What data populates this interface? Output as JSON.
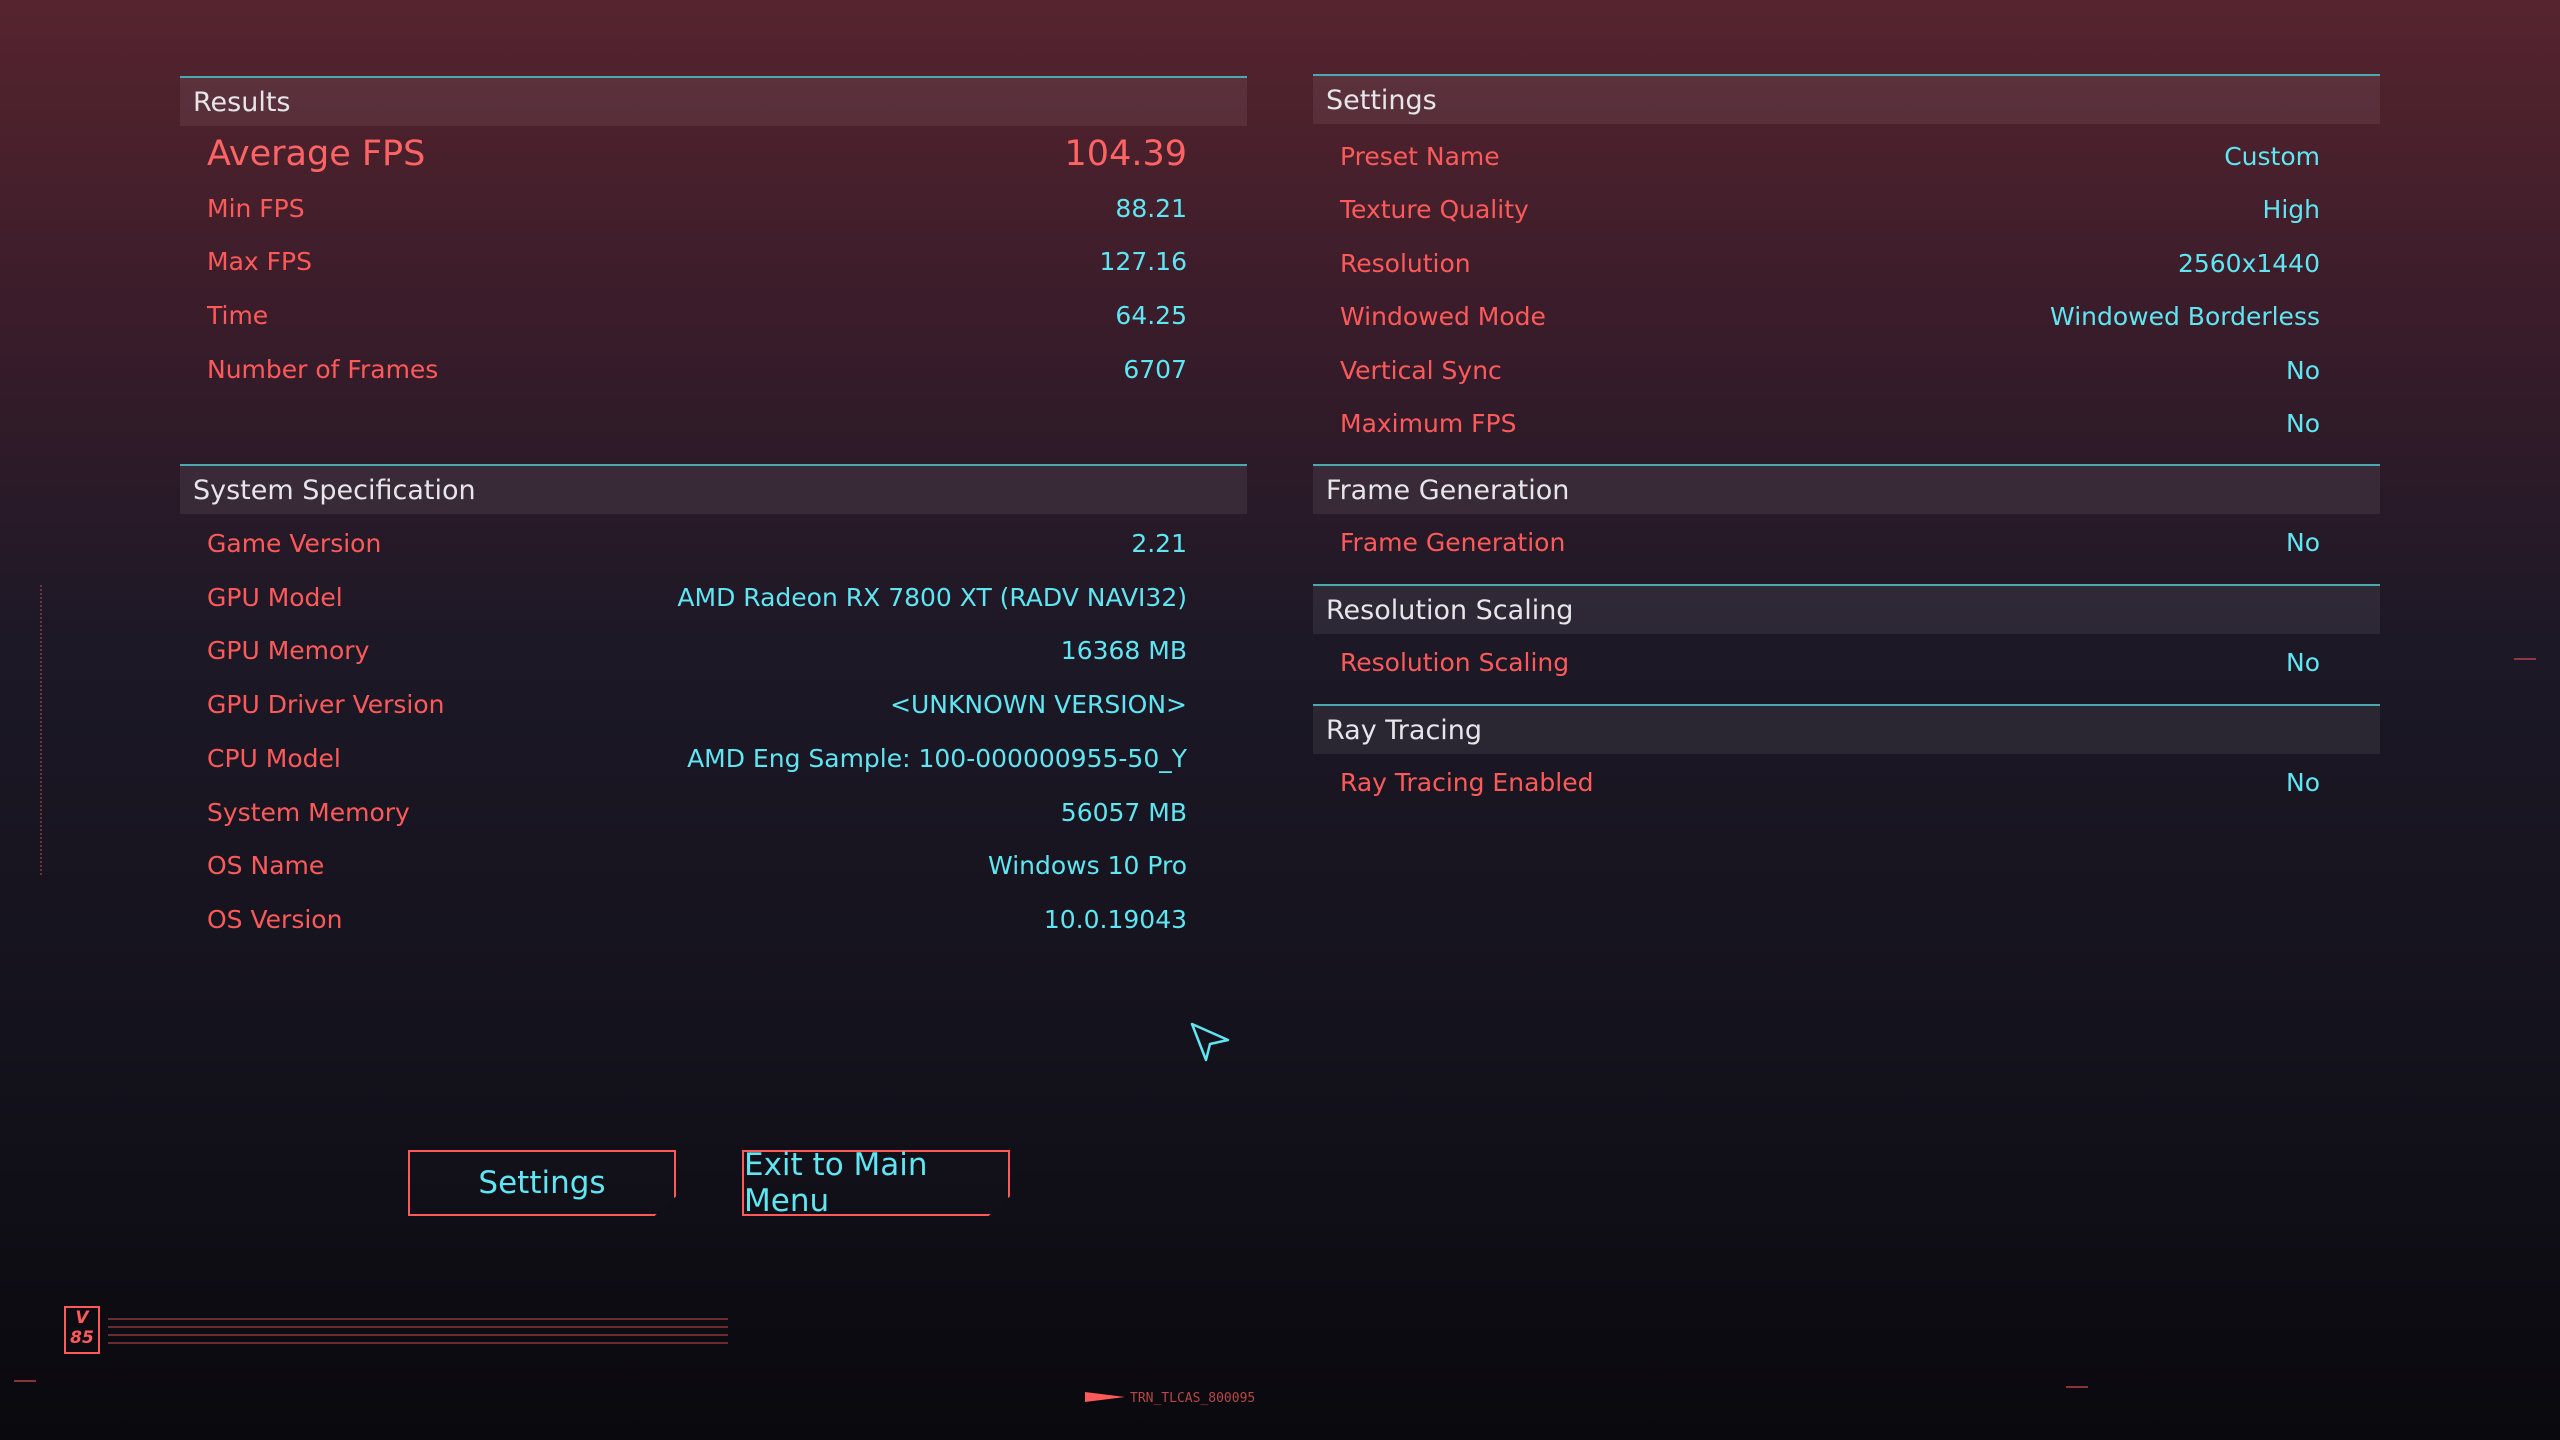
{
  "results": {
    "title": "Results",
    "average_fps_label": "Average FPS",
    "average_fps_value": "104.39",
    "rows": [
      {
        "label": "Min FPS",
        "value": "88.21"
      },
      {
        "label": "Max FPS",
        "value": "127.16"
      },
      {
        "label": "Time",
        "value": "64.25"
      },
      {
        "label": "Number of Frames",
        "value": "6707"
      }
    ]
  },
  "system": {
    "title": "System Specification",
    "rows": [
      {
        "label": "Game Version",
        "value": "2.21"
      },
      {
        "label": "GPU Model",
        "value": "AMD Radeon RX 7800 XT (RADV NAVI32)"
      },
      {
        "label": "GPU Memory",
        "value": "16368 MB"
      },
      {
        "label": "GPU Driver Version",
        "value": "<UNKNOWN VERSION>"
      },
      {
        "label": "CPU Model",
        "value": "AMD Eng Sample: 100-000000955-50_Y"
      },
      {
        "label": "System Memory",
        "value": "56057 MB"
      },
      {
        "label": "OS Name",
        "value": "Windows 10 Pro"
      },
      {
        "label": "OS Version",
        "value": "10.0.19043"
      }
    ]
  },
  "settings": {
    "title": "Settings",
    "rows": [
      {
        "label": "Preset Name",
        "value": "Custom"
      },
      {
        "label": "Texture Quality",
        "value": "High"
      },
      {
        "label": "Resolution",
        "value": "2560x1440"
      },
      {
        "label": "Windowed Mode",
        "value": "Windowed Borderless"
      },
      {
        "label": "Vertical Sync",
        "value": "No"
      },
      {
        "label": "Maximum FPS",
        "value": "No"
      }
    ]
  },
  "frame_generation": {
    "title": "Frame Generation",
    "rows": [
      {
        "label": "Frame Generation",
        "value": "No"
      }
    ]
  },
  "resolution_scaling": {
    "title": "Resolution Scaling",
    "rows": [
      {
        "label": "Resolution Scaling",
        "value": "No"
      }
    ]
  },
  "ray_tracing": {
    "title": "Ray Tracing",
    "rows": [
      {
        "label": "Ray Tracing Enabled",
        "value": "No"
      }
    ]
  },
  "buttons": {
    "settings_label": "Settings",
    "exit_label": "Exit to Main Menu"
  },
  "footer": {
    "logo_text": "V 85",
    "code_text": "TRN_TLCAS_800095"
  },
  "colors": {
    "label": "#ff5a5a",
    "value": "#5fe6f2",
    "header_line": "#4aa8b0"
  }
}
